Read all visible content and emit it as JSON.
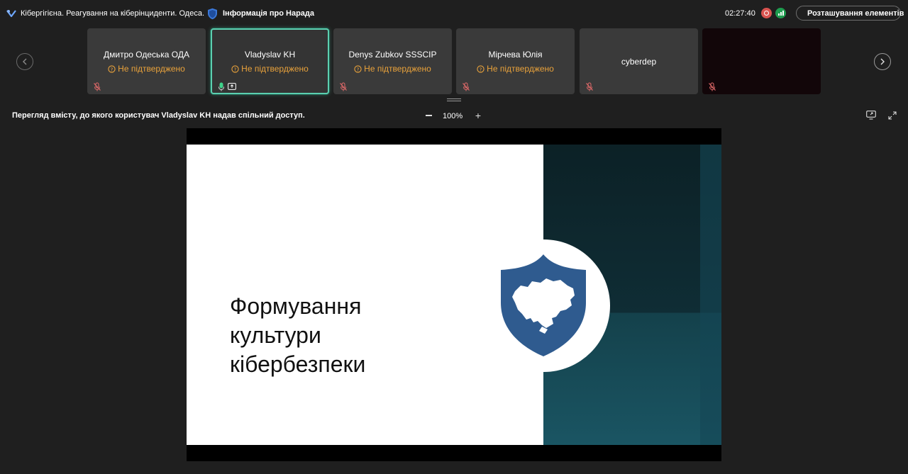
{
  "title_bar": {
    "meeting_title": "Кібергігієна. Реагування на кіберінциденти. Одеса.",
    "info_label": "Інформація про Нарада",
    "timer": "02:27:40",
    "layout_button_label": "Розташування елементів",
    "meeting_icon": "teams-logo-icon",
    "info_icon": "shield-info-icon",
    "record_icon": "record-icon",
    "network_icon": "network-quality-icon"
  },
  "participants": [
    {
      "name": "Дмитро Одеська ОДА",
      "status": "Не підтверджено",
      "mic": "muted"
    },
    {
      "name": "Vladyslav KH",
      "status": "Не підтверджено",
      "mic": "on",
      "sharing": true,
      "active": true
    },
    {
      "name": "Denys Zubkov SSSCIP",
      "status": "Не підтверджено",
      "mic": "muted"
    },
    {
      "name": "Мірчева Юлія",
      "status": "Не підтверджено",
      "mic": "muted"
    },
    {
      "name": "cyberdep",
      "status": "",
      "mic": "muted"
    },
    {
      "name": "",
      "status": "",
      "mic": "muted"
    }
  ],
  "content": {
    "caption": "Перегляд вмісту, до якого користувач Vladyslav KH надав спільний доступ.",
    "zoom_level": "100%"
  },
  "slide": {
    "title_lines": [
      "Формування",
      "культури",
      "кібербезпеки"
    ]
  },
  "colors": {
    "background": "#1f1f1f",
    "tile": "#3a3a3a",
    "active_border": "#5ccfb0",
    "warning": "#e9a23b",
    "shield": "#2f5b8f",
    "slide_dark": "#0f2d35"
  }
}
